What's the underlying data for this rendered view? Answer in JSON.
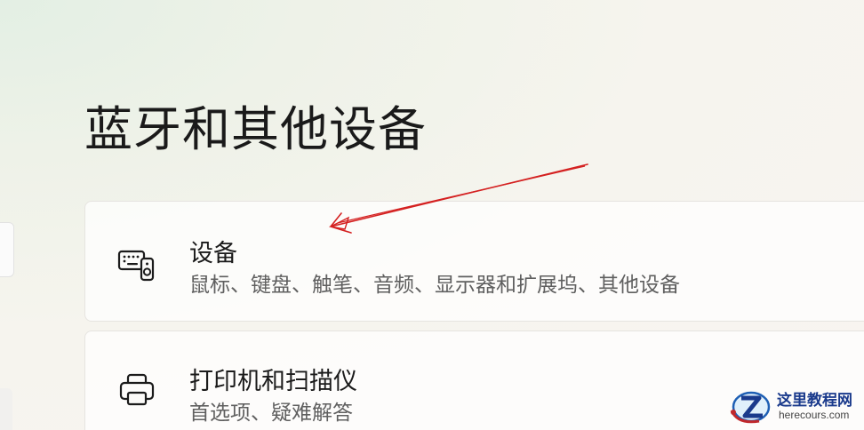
{
  "page": {
    "title": "蓝牙和其他设备"
  },
  "cards": {
    "devices": {
      "icon": "keyboard-speaker-icon",
      "title": "设备",
      "subtitle": "鼠标、键盘、触笔、音频、显示器和扩展坞、其他设备"
    },
    "printers": {
      "icon": "printer-icon",
      "title": "打印机和扫描仪",
      "subtitle": "首选项、疑难解答"
    }
  },
  "annotation": {
    "arrow_color": "#d42020"
  },
  "watermark": {
    "name": "这里教程网",
    "url": "herecours.com"
  },
  "colors": {
    "accent_red": "#d42020",
    "watermark_blue": "#1a3a8c"
  }
}
